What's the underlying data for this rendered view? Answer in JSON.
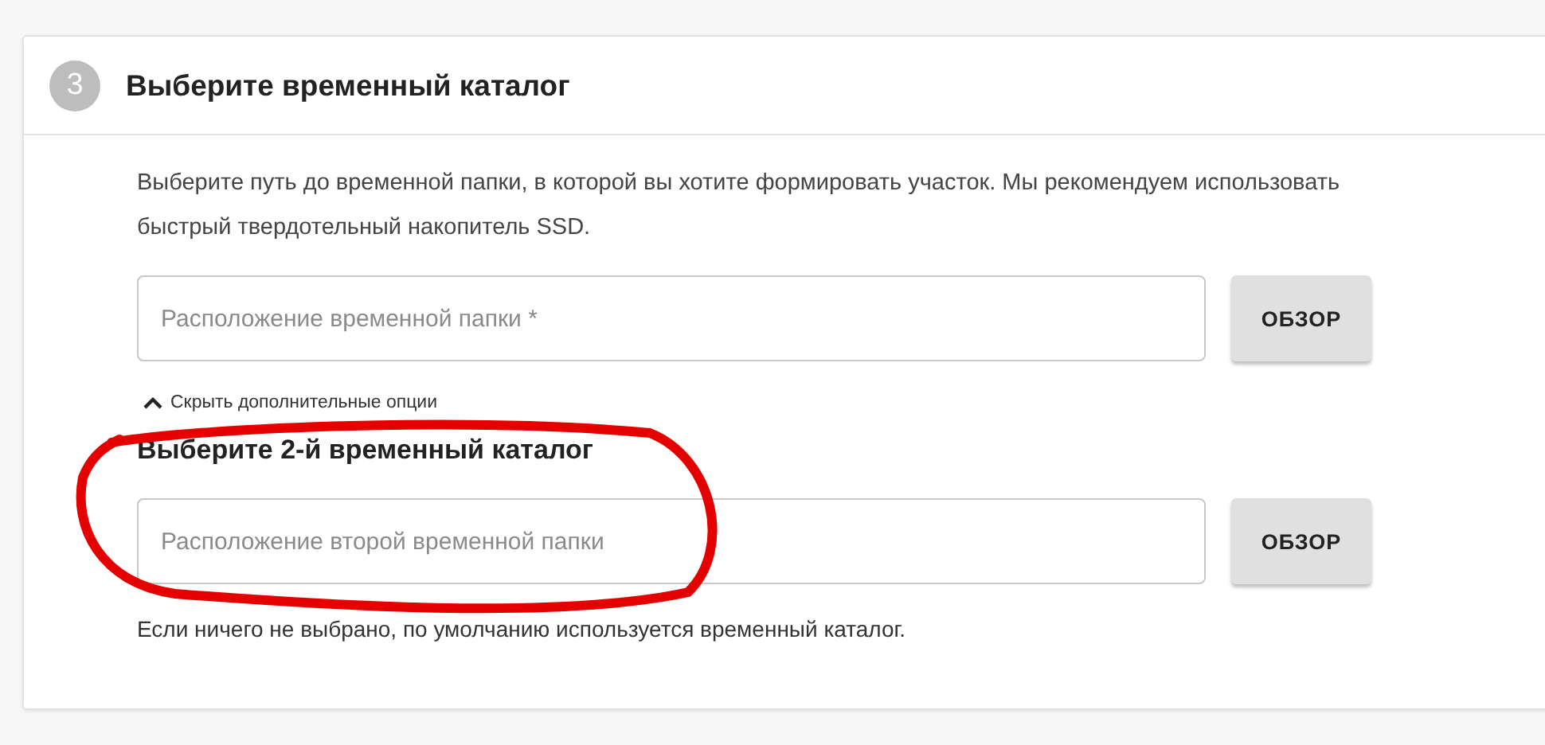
{
  "step": {
    "number": "3",
    "title": "Выберите временный каталог"
  },
  "description": "Выберите путь до временной папки, в которой вы хотите формировать участок. Мы рекомендуем использовать быстрый твердотельный накопитель SSD.",
  "primary_field": {
    "placeholder": "Расположение временной папки *",
    "button": "ОБЗОР"
  },
  "options_toggle": {
    "label": "Скрыть дополнительные опции",
    "expanded": true
  },
  "secondary": {
    "title": "Выберите 2-й временный каталог",
    "field": {
      "placeholder": "Расположение второй временной папки",
      "button": "ОБЗОР"
    },
    "hint": "Если ничего не выбрано, по умолчанию используется временный каталог."
  },
  "annotation": {
    "kind": "circle"
  }
}
